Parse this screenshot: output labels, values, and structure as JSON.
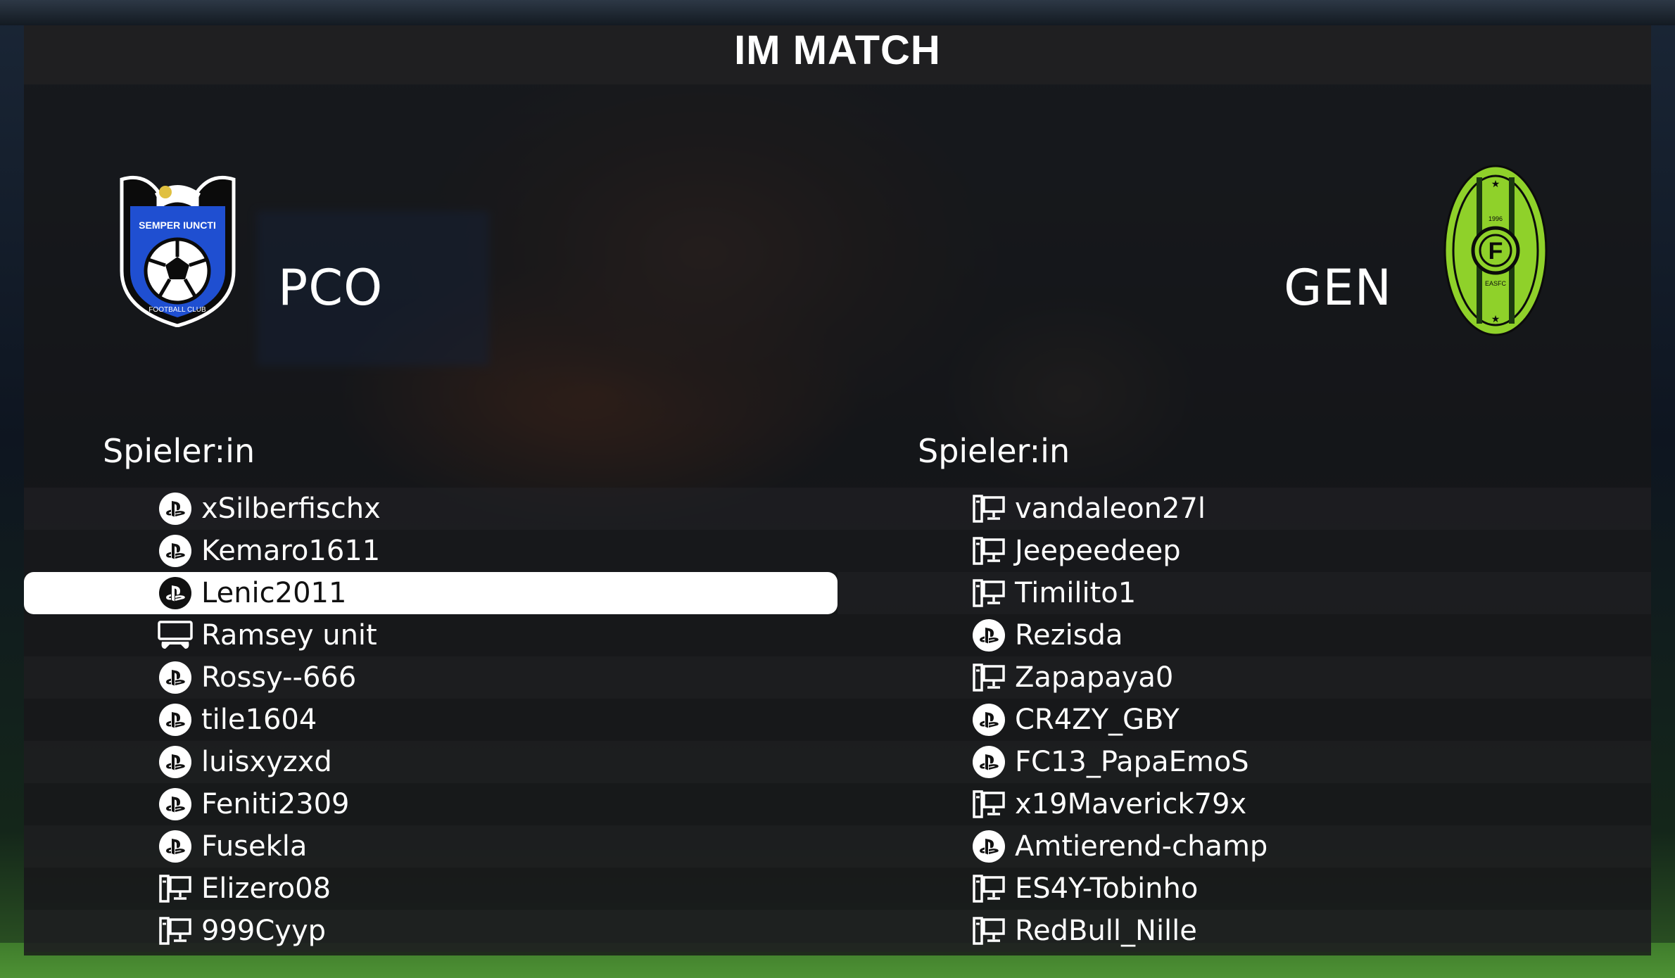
{
  "header": {
    "title": "IM MATCH"
  },
  "home_team": {
    "abbr": "PCO",
    "crest_text": "SEMPER IUNCTI",
    "crest_sub": "FOOTBALL CLUB",
    "color": "#1f4fd1"
  },
  "away_team": {
    "abbr": "GEN",
    "crest_letter": "F",
    "crest_year": "1996",
    "crest_sub": "EASFC",
    "color": "#8fd12a"
  },
  "home_players": {
    "header": "Spieler:in",
    "rows": [
      {
        "name": "xSilberfischx",
        "platform": "playstation"
      },
      {
        "name": "Kemaro1611",
        "platform": "playstation"
      },
      {
        "name": "Lenic2011",
        "platform": "playstation",
        "selected": true
      },
      {
        "name": "Ramsey unit",
        "platform": "controller"
      },
      {
        "name": "Rossy--666",
        "platform": "playstation"
      },
      {
        "name": "tile1604",
        "platform": "playstation"
      },
      {
        "name": "luisxyzxd",
        "platform": "playstation"
      },
      {
        "name": "Feniti2309",
        "platform": "playstation"
      },
      {
        "name": "Fusekla",
        "platform": "playstation"
      },
      {
        "name": "Elizero08",
        "platform": "pc"
      },
      {
        "name": "999Cyyp",
        "platform": "pc"
      }
    ]
  },
  "away_players": {
    "header": "Spieler:in",
    "rows": [
      {
        "name": "vandaleon27l",
        "platform": "pc"
      },
      {
        "name": "Jeepeedeep",
        "platform": "pc"
      },
      {
        "name": "Timilito1",
        "platform": "pc"
      },
      {
        "name": "Rezisda",
        "platform": "playstation"
      },
      {
        "name": "Zapapaya0",
        "platform": "pc"
      },
      {
        "name": "CR4ZY_GBY",
        "platform": "playstation"
      },
      {
        "name": "FC13_PapaEmoS",
        "platform": "playstation"
      },
      {
        "name": "x19Maverick79x",
        "platform": "pc"
      },
      {
        "name": "Amtierend-champ",
        "platform": "playstation"
      },
      {
        "name": "ES4Y-Tobinho",
        "platform": "pc"
      },
      {
        "name": "RedBull_Nille",
        "platform": "pc"
      }
    ]
  }
}
